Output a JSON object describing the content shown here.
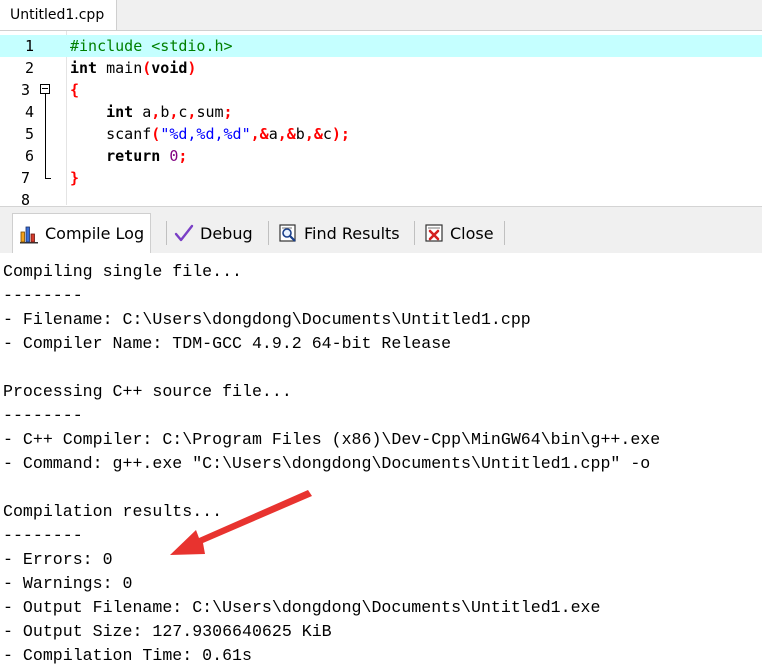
{
  "editor": {
    "file_tab": "Untitled1.cpp",
    "lines": [
      {
        "n": "1"
      },
      {
        "n": "2"
      },
      {
        "n": "3"
      },
      {
        "n": "4"
      },
      {
        "n": "5"
      },
      {
        "n": "6"
      },
      {
        "n": "7"
      },
      {
        "n": "8"
      }
    ],
    "code": {
      "l1_pp": "#include <stdio.h>",
      "l2_kw1": "int",
      "l2_txt": " main",
      "l2_op1": "(",
      "l2_kw2": "void",
      "l2_op2": ")",
      "l3_op": "{",
      "l4_indent": "    ",
      "l4_kw": "int",
      "l4_a": " a",
      "l4_c1": ",",
      "l4_b": "b",
      "l4_c2": ",",
      "l4_c": "c",
      "l4_c3": ",",
      "l4_sum": "sum",
      "l4_semi": ";",
      "l5_indent": "    ",
      "l5_fn": "scanf",
      "l5_op1": "(",
      "l5_str": "\"%d,%d,%d\"",
      "l5_op2": ",&",
      "l5_a": "a",
      "l5_op3": ",&",
      "l5_b": "b",
      "l5_op4": ",&",
      "l5_c": "c",
      "l5_op5": ");",
      "l6_indent": "    ",
      "l6_kw": "return",
      "l6_sp": " ",
      "l6_num": "0",
      "l6_semi": ";",
      "l7_op": "}"
    }
  },
  "panel": {
    "tabs": {
      "compile_log": "Compile Log",
      "debug": "Debug",
      "find_results": "Find Results",
      "close": "Close"
    },
    "icons": {
      "compile_log": "bar-chart-icon",
      "debug": "checkmark-icon",
      "find_results": "magnifier-document-icon",
      "close": "close-document-icon"
    }
  },
  "log": {
    "lines": [
      "Compiling single file...",
      "--------",
      "- Filename: C:\\Users\\dongdong\\Documents\\Untitled1.cpp",
      "- Compiler Name: TDM-GCC 4.9.2 64-bit Release",
      "",
      "Processing C++ source file...",
      "--------",
      "- C++ Compiler: C:\\Program Files (x86)\\Dev-Cpp\\MinGW64\\bin\\g++.exe",
      "- Command: g++.exe \"C:\\Users\\dongdong\\Documents\\Untitled1.cpp\" -o",
      "",
      "Compilation results...",
      "--------",
      "- Errors: 0",
      "- Warnings: 0",
      "- Output Filename: C:\\Users\\dongdong\\Documents\\Untitled1.exe",
      "- Output Size: 127.9306640625 KiB",
      "- Compilation Time: 0.61s"
    ]
  },
  "colors": {
    "active_line": "#c5ffff",
    "annotation_arrow": "#e8332f",
    "preprocessor": "#008000",
    "operator": "#ff0000",
    "string": "#0000ff",
    "number": "#800080"
  }
}
